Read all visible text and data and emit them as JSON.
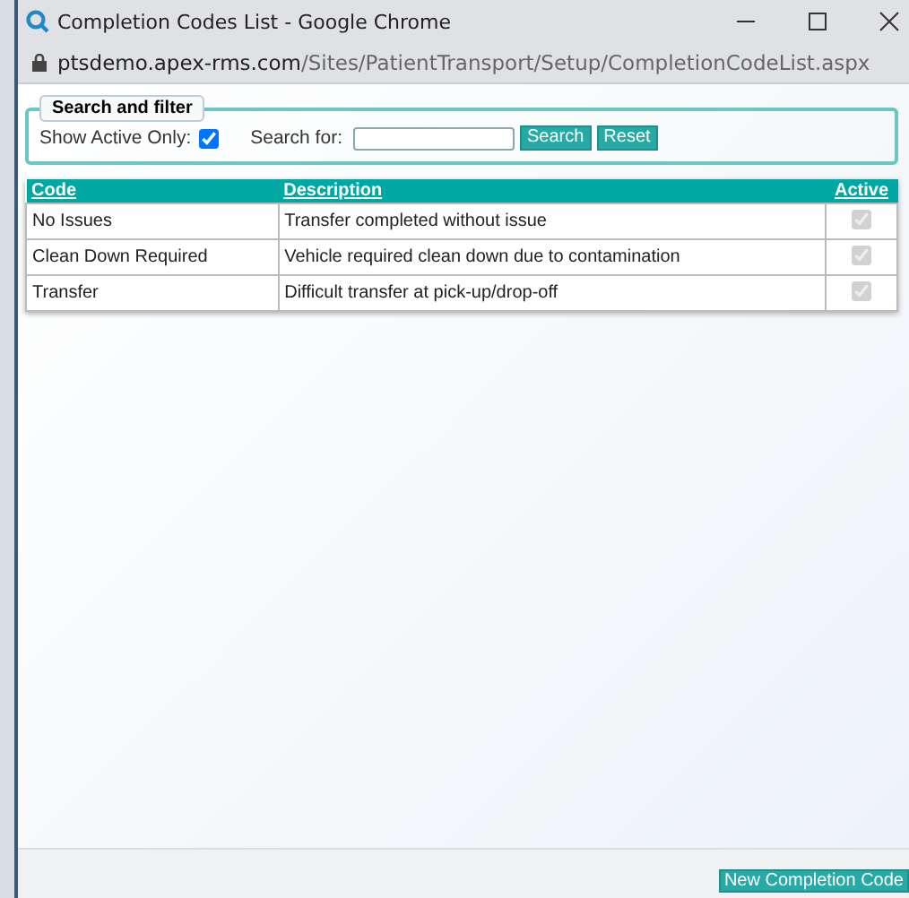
{
  "window": {
    "title": "Completion Codes List - Google Chrome"
  },
  "address_bar": {
    "host": "ptsdemo.apex-rms.com",
    "path": "/Sites/PatientTransport/Setup/CompletionCodeList.aspx"
  },
  "filter": {
    "legend": "Search and filter",
    "active_only_label": "Show Active Only:",
    "active_only_checked": true,
    "search_label": "Search for:",
    "search_button": "Search",
    "reset_button": "Reset"
  },
  "table": {
    "columns": [
      "Code",
      "Description",
      "Active"
    ],
    "rows": [
      {
        "code": "No Issues",
        "description": "Transfer completed without issue",
        "active": true
      },
      {
        "code": "Clean Down Required",
        "description": "Vehicle required clean down due to contamination",
        "active": true
      },
      {
        "code": "Transfer",
        "description": "Difficult transfer at pick-up/drop-off",
        "active": true
      }
    ]
  },
  "footer": {
    "button": "New Completion Code"
  }
}
